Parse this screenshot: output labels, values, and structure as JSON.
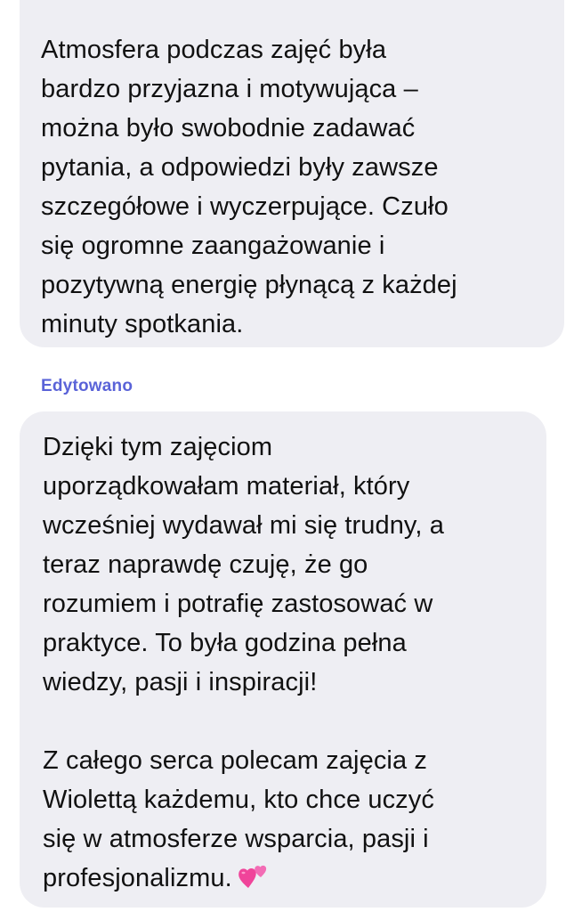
{
  "messages": [
    {
      "lines": [
        "Atmosfera podczas zajęć była",
        "bardzo przyjazna i motywująca –",
        "można było swobodnie zadawać",
        "pytania, a odpowiedzi były zawsze",
        "szczegółowe i wyczerpujące. Czuło",
        "się ogromne zaangażowanie i",
        "pozytywną energię płynącą z każdej",
        "minuty spotkania."
      ]
    },
    {
      "edited_label": "Edytowano",
      "paragraph1": [
        "Dzięki tym zajęciom",
        "uporządkowałam materiał, który",
        "wcześniej wydawał mi się trudny, a",
        "teraz naprawdę czuję, że go",
        "rozumiem i potrafię zastosować w",
        "praktyce. To była godzina pełna",
        "wiedzy, pasji i inspiracji!"
      ],
      "paragraph2": [
        "Z całego serca polecam zajęcia z",
        "Wiolettą każdemu, kto chce uczyć",
        "się w atmosferze wsparcia, pasji i",
        "profesjonalizmu."
      ],
      "emoji": "two-hearts-icon",
      "emoji_color": "#f0449a"
    }
  ],
  "colors": {
    "bubble_bg": "#eeeef3",
    "text": "#111111",
    "edited_label": "#5a63d8"
  }
}
